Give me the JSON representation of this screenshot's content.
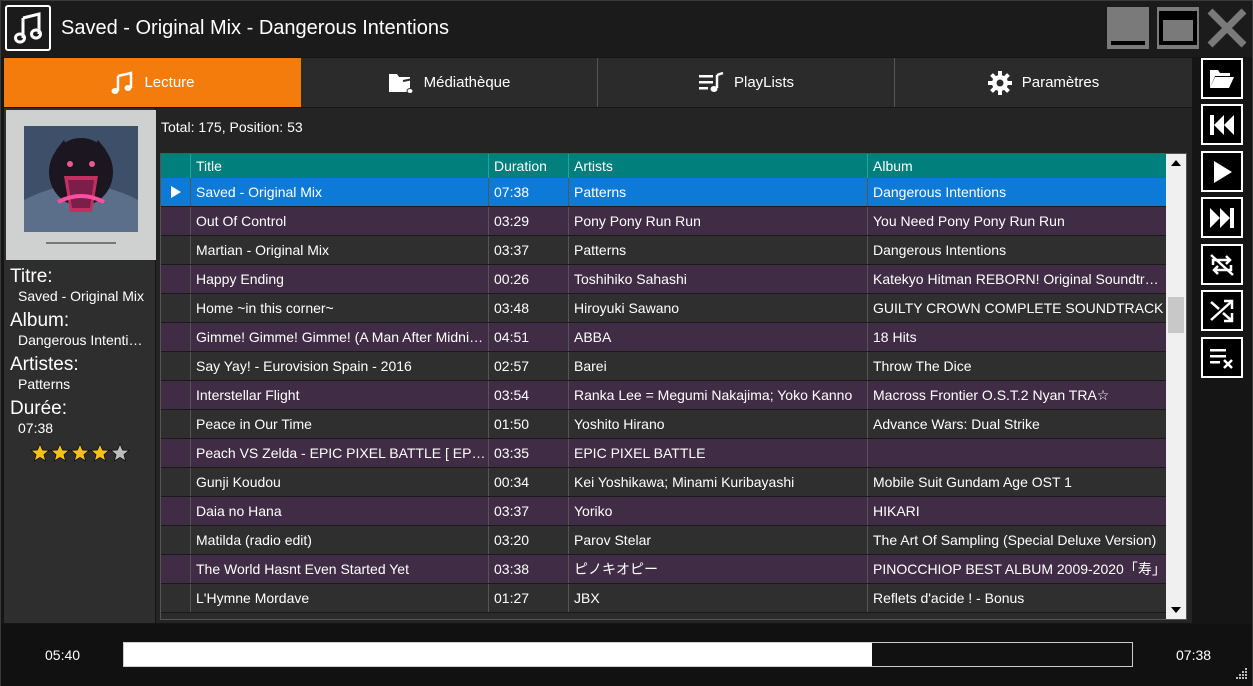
{
  "window": {
    "title": "Saved - Original Mix - Dangerous Intentions"
  },
  "tabs": [
    {
      "label": "Lecture",
      "icon": "music-note-icon",
      "active": true
    },
    {
      "label": "Médiathèque",
      "icon": "music-folder-icon",
      "active": false
    },
    {
      "label": "PlayLists",
      "icon": "playlist-icon",
      "active": false
    },
    {
      "label": "Paramètres",
      "icon": "gear-icon",
      "active": false
    }
  ],
  "now_playing": {
    "title_label": "Titre:",
    "title": "Saved - Original Mix",
    "album_label": "Album:",
    "album": "Dangerous Intentions",
    "artists_label": "Artistes:",
    "artists": "Patterns",
    "duration_label": "Durée:",
    "duration": "07:38",
    "rating": 4,
    "rating_max": 5
  },
  "playlist": {
    "summary": "Total: 175, Position: 53",
    "columns": [
      "",
      "Title",
      "Duration",
      "Artists",
      "Album"
    ],
    "rows": [
      {
        "title": "Saved - Original Mix",
        "duration": "07:38",
        "artists": "Patterns",
        "album": "Dangerous Intentions",
        "playing": true
      },
      {
        "title": "Out Of Control",
        "duration": "03:29",
        "artists": "Pony Pony Run Run",
        "album": "You Need Pony Pony Run Run"
      },
      {
        "title": "Martian - Original Mix",
        "duration": "03:37",
        "artists": "Patterns",
        "album": "Dangerous Intentions"
      },
      {
        "title": "Happy Ending",
        "duration": "00:26",
        "artists": "Toshihiko Sahashi",
        "album": "Katekyo Hitman REBORN! Original Soundtrack"
      },
      {
        "title": "Home ~in this corner~",
        "duration": "03:48",
        "artists": "Hiroyuki Sawano",
        "album": "GUILTY CROWN COMPLETE SOUNDTRACK"
      },
      {
        "title": "Gimme! Gimme! Gimme! (A Man After Midnight)",
        "duration": "04:51",
        "artists": "ABBA",
        "album": "18 Hits"
      },
      {
        "title": "Say Yay! - Eurovision Spain - 2016",
        "duration": "02:57",
        "artists": "Barei",
        "album": "Throw The Dice"
      },
      {
        "title": "Interstellar Flight",
        "duration": "03:54",
        "artists": "Ranka Lee = Megumi Nakajima; Yoko Kanno",
        "album": "Macross Frontier O.S.T.2 Nyan TRA☆"
      },
      {
        "title": "Peace in Our Time",
        "duration": "01:50",
        "artists": "Yoshito Hirano",
        "album": "Advance Wars: Dual Strike"
      },
      {
        "title": "Peach VS Zelda - EPIC PIXEL BATTLE [ EPB ]",
        "duration": "03:35",
        "artists": "EPIC PIXEL BATTLE",
        "album": ""
      },
      {
        "title": "Gunji Koudou",
        "duration": "00:34",
        "artists": "Kei Yoshikawa; Minami Kuribayashi",
        "album": "Mobile Suit Gundam Age OST 1"
      },
      {
        "title": "Daia no Hana",
        "duration": "03:37",
        "artists": "Yoriko",
        "album": "HIKARI"
      },
      {
        "title": "Matilda (radio edit)",
        "duration": "03:20",
        "artists": "Parov Stelar",
        "album": "The Art Of Sampling (Special Deluxe Version)"
      },
      {
        "title": "The World Hasnt Even Started Yet",
        "duration": "03:38",
        "artists": "ピノキオピー",
        "album": "PINOCCHIOP BEST ALBUM 2009-2020「寿」"
      },
      {
        "title": "L'Hymne Mordave",
        "duration": "01:27",
        "artists": "JBX",
        "album": "Reflets d'acide ! - Bonus"
      }
    ]
  },
  "side_buttons": [
    {
      "name": "open-folder-button",
      "icon": "open-folder-icon"
    },
    {
      "name": "previous-button",
      "icon": "skip-previous-icon"
    },
    {
      "name": "play-button",
      "icon": "play-icon"
    },
    {
      "name": "next-button",
      "icon": "skip-next-icon"
    },
    {
      "name": "repeat-button",
      "icon": "repeat-off-icon"
    },
    {
      "name": "shuffle-button",
      "icon": "shuffle-icon"
    },
    {
      "name": "clear-playlist-button",
      "icon": "clear-playlist-icon"
    }
  ],
  "player": {
    "current_time": "05:40",
    "total_time": "07:38",
    "progress": 0.742
  },
  "colors": {
    "accent": "#f47c0c",
    "header": "#007f7d",
    "selected_row": "#0d7ad8",
    "odd_row": "#402c44",
    "even_row": "#2f2f2f"
  }
}
